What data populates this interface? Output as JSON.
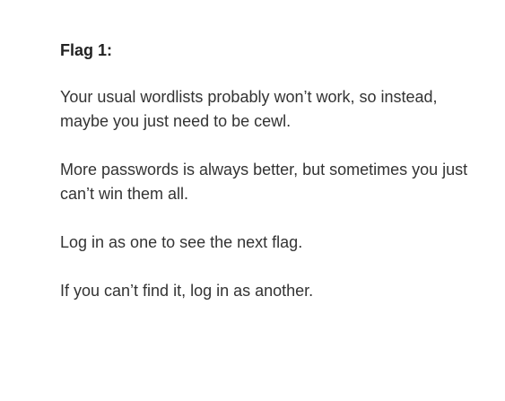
{
  "post": {
    "heading": "Flag 1:",
    "paragraphs": [
      "Your usual wordlists probably won’t work, so instead, maybe you just need to be cewl.",
      "More passwords is always better, but sometimes you just can’t win them all.",
      "Log in as one to see the next flag.",
      "If you can’t find it, log in as another."
    ]
  },
  "colors": {
    "background": "#ffffff",
    "text": "#333333",
    "heading": "#222222"
  }
}
